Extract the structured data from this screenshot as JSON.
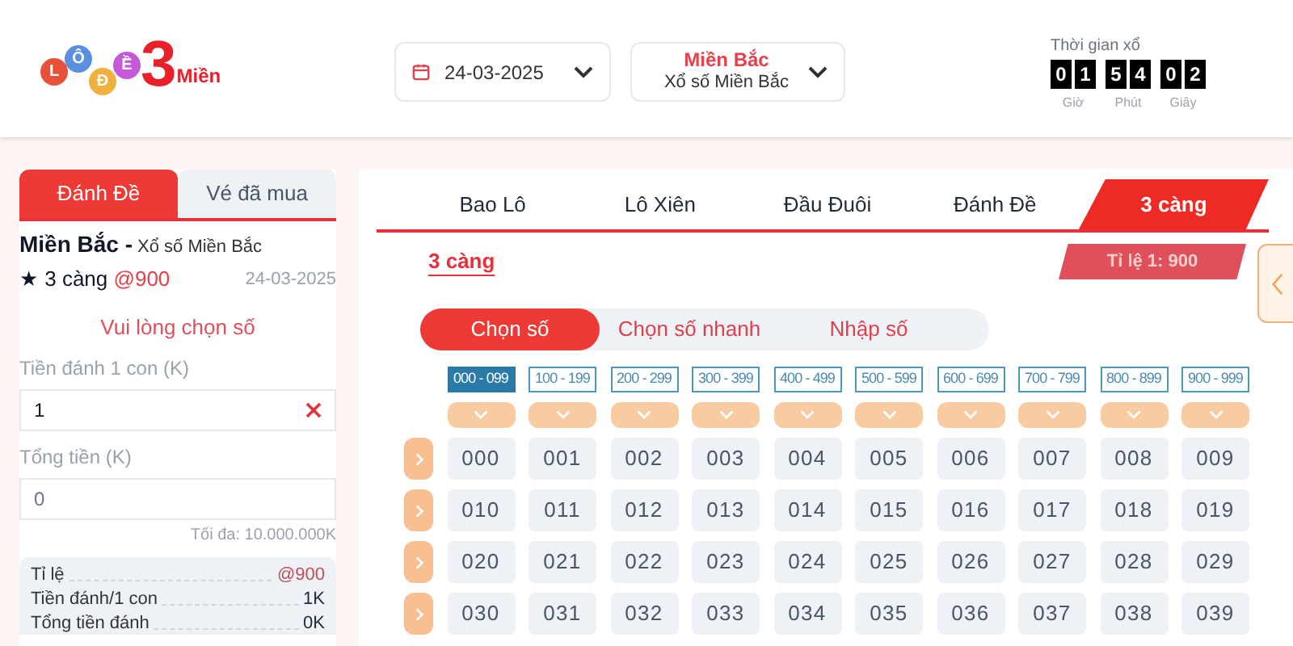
{
  "logo": {
    "letters": [
      "L",
      "Ô",
      "Đ",
      "Ề"
    ],
    "number": "3",
    "word": "Miền"
  },
  "date_picker": {
    "value": "24-03-2025"
  },
  "region_picker": {
    "title": "Miền Bắc",
    "subtitle": "Xổ số Miền Bắc"
  },
  "countdown": {
    "label": "Thời gian xổ",
    "units": [
      {
        "digits": [
          "0",
          "1"
        ],
        "label": "Giờ"
      },
      {
        "digits": [
          "5",
          "4"
        ],
        "label": "Phút"
      },
      {
        "digits": [
          "0",
          "2"
        ],
        "label": "Giây"
      }
    ]
  },
  "side_tabs": [
    {
      "label": "Đánh Đề",
      "selected": true
    },
    {
      "label": "Vé đã mua",
      "selected": false
    }
  ],
  "ticket": {
    "region": "Miền Bắc -",
    "lottery": "Xổ số Miền Bắc",
    "bet": "★ 3 càng",
    "odds": "@900",
    "date": "24-03-2025",
    "prompt": "Vui lòng chọn số",
    "stake_label": "Tiền đánh 1 con (K)",
    "stake_value": "1",
    "total_label": "Tổng tiền (K)",
    "total_placeholder": "0",
    "max": "Tối đa: 10.000.000K"
  },
  "summary": [
    {
      "label": "Tỉ lệ",
      "value": "@900",
      "highlight": true
    },
    {
      "label": "Tiền đánh/1 con",
      "value": "1K",
      "highlight": false
    },
    {
      "label": "Tổng tiền đánh",
      "value": "0K",
      "highlight": false
    }
  ],
  "game_tabs": [
    {
      "label": "Bao Lô",
      "selected": false
    },
    {
      "label": "Lô Xiên",
      "selected": false
    },
    {
      "label": "Đầu Đuôi",
      "selected": false
    },
    {
      "label": "Đánh Đề",
      "selected": false
    },
    {
      "label": "3 càng",
      "selected": true
    }
  ],
  "section_title": "3 càng",
  "odds_badge": "Tỉ lệ 1: 900",
  "modes": [
    {
      "label": "Chọn số",
      "selected": true
    },
    {
      "label": "Chọn số nhanh",
      "selected": false
    },
    {
      "label": "Nhập số",
      "selected": false
    }
  ],
  "ranges": [
    {
      "label": "000 - 099",
      "selected": true
    },
    {
      "label": "100 - 199",
      "selected": false
    },
    {
      "label": "200 - 299",
      "selected": false
    },
    {
      "label": "300 - 399",
      "selected": false
    },
    {
      "label": "400 - 499",
      "selected": false
    },
    {
      "label": "500 - 599",
      "selected": false
    },
    {
      "label": "600 - 699",
      "selected": false
    },
    {
      "label": "700 - 799",
      "selected": false
    },
    {
      "label": "800 - 899",
      "selected": false
    },
    {
      "label": "900 - 999",
      "selected": false
    }
  ],
  "numbers": [
    [
      "000",
      "001",
      "002",
      "003",
      "004",
      "005",
      "006",
      "007",
      "008",
      "009"
    ],
    [
      "010",
      "011",
      "012",
      "013",
      "014",
      "015",
      "016",
      "017",
      "018",
      "019"
    ],
    [
      "020",
      "021",
      "022",
      "023",
      "024",
      "025",
      "026",
      "027",
      "028",
      "029"
    ],
    [
      "030",
      "031",
      "032",
      "033",
      "034",
      "035",
      "036",
      "037",
      "038",
      "039"
    ]
  ]
}
